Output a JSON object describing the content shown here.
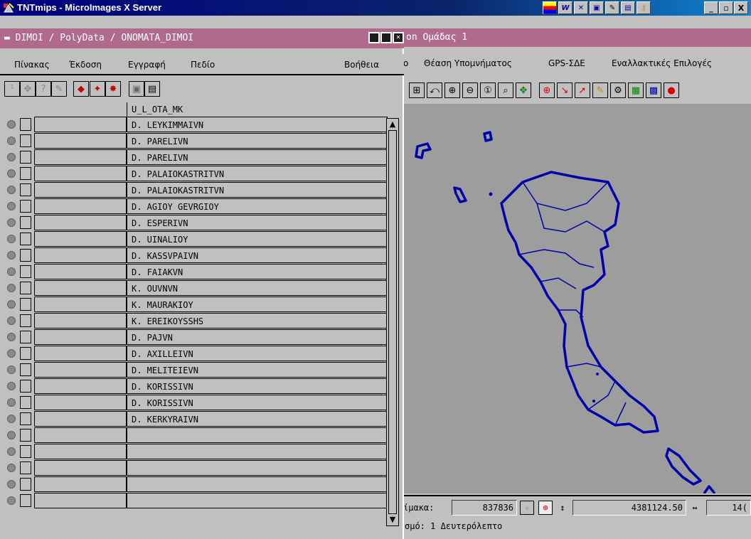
{
  "app": {
    "title": "TNTmips - MicroImages X Server",
    "tray_icons": [
      "palette-icon",
      "w-icon",
      "x-icon",
      "window-icon",
      "tools-icon",
      "layout-icon",
      "key-icon"
    ],
    "window_controls": [
      "_",
      "▫",
      "X"
    ]
  },
  "table_window": {
    "title": "DIMOI / PolyData / ONOMATA_DIMOI",
    "menu": [
      "Πίνακας",
      "Έκδοση",
      "Εγγραφή",
      "Πεδίο"
    ],
    "help": "Βοήθεια",
    "column_header": "U_L_OTA_MK",
    "rows": [
      "D. LEYKIMMAIVN",
      "D. PARELIVN",
      "D. PARELIVN",
      "D. PALAIOKASTRITVN",
      "D. PALAIOKASTRITVN",
      "D. AGIOY GEVRGIOY",
      "D. ESPERIVN",
      "D. UINALIOY",
      "D. KASSVPAIVN",
      "D. FAIAKVN",
      "K. OUVNVN",
      "K. MAURAKIOY",
      "K. EREIKOYSSHS",
      "D. PAJVN",
      "D. AXILLEIVN",
      "D. MELITEIEVN",
      "D. KORISSIVN",
      "D. KORISSIVN",
      "D. KERKYRAIVN",
      "",
      "",
      "",
      "",
      ""
    ]
  },
  "map_window": {
    "title": "on Ομάδας 1",
    "menu": [
      "o",
      "Θέαση Υπομνήματος",
      "GPS-ΣΔΕ",
      "Εναλλακτικές Επιλογές"
    ],
    "coord_label": "ίμακα:",
    "x_value": "837836",
    "y_value": "4381124.50",
    "extra_value": "14(",
    "status": "σμό: 1 Δευτερόλεπτο",
    "colors": {
      "map_bg": "#9d9d9d",
      "outline": "#0000aa"
    }
  }
}
